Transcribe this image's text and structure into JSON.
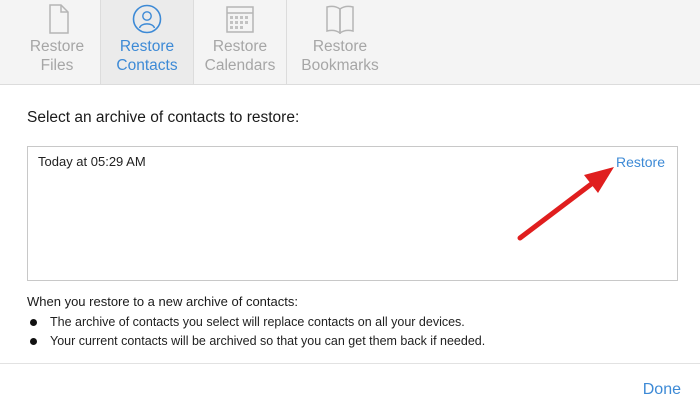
{
  "tabs": [
    {
      "label": "Restore\nFiles",
      "icon": "document-icon",
      "active": false
    },
    {
      "label": "Restore\nContacts",
      "icon": "contact-icon",
      "active": true
    },
    {
      "label": "Restore\nCalendars",
      "icon": "calendar-icon",
      "active": false
    },
    {
      "label": "Restore\nBookmarks",
      "icon": "book-icon",
      "active": false
    }
  ],
  "main": {
    "heading": "Select an archive of contacts to restore:",
    "archives": [
      {
        "date": "Today at 05:29 AM",
        "action": "Restore"
      }
    ],
    "annotation": {
      "type": "red-arrow",
      "color": "#e01e1e"
    }
  },
  "info": {
    "title": "When you restore to a new archive of contacts:",
    "bullets": [
      "The archive of contacts you select will replace contacts on all your devices.",
      "Your current contacts will be archived so that you can get them back if needed."
    ]
  },
  "footer": {
    "done_label": "Done"
  },
  "colors": {
    "accent": "#3d8ad6",
    "inactive": "#a6a6a6",
    "arrow": "#e01e1e"
  }
}
